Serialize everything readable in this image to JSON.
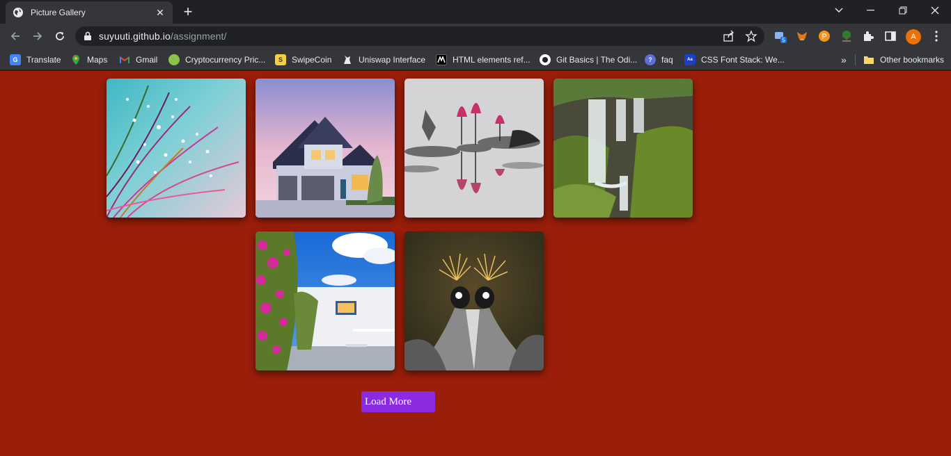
{
  "browser": {
    "tab_title": "Picture Gallery",
    "url_host": "suyuuti.github.io",
    "url_path": "/assignment/",
    "profile_initial": "A",
    "extension_badge": "5"
  },
  "bookmarks": [
    {
      "label": "Translate",
      "icon": "google-translate-icon",
      "color": "#4285f4"
    },
    {
      "label": "Maps",
      "icon": "maps-icon",
      "color": "#34a853"
    },
    {
      "label": "Gmail",
      "icon": "gmail-icon",
      "color": "#ea4335"
    },
    {
      "label": "Cryptocurrency Pric...",
      "icon": "coin-icon",
      "color": "#8bc34a"
    },
    {
      "label": "SwipeCoin",
      "icon": "swipecoin-icon",
      "color": "#f4d03f"
    },
    {
      "label": "Uniswap Interface",
      "icon": "unicorn-icon",
      "color": "#ffffff"
    },
    {
      "label": "HTML elements ref...",
      "icon": "mdn-icon",
      "color": "#000000"
    },
    {
      "label": "Git Basics | The Odi...",
      "icon": "odin-icon",
      "color": "#ffffff"
    },
    {
      "label": "faq",
      "icon": "faq-icon",
      "color": "#5b6ee1"
    },
    {
      "label": "CSS Font Stack: We...",
      "icon": "cssfontstack-icon",
      "color": "#1a3fc9"
    }
  ],
  "other_bookmarks_label": "Other bookmarks",
  "gallery": {
    "images": [
      {
        "subject": "dandelion-dewdrops"
      },
      {
        "subject": "house-at-dusk"
      },
      {
        "subject": "water-lilies"
      },
      {
        "subject": "waterfall"
      },
      {
        "subject": "bougainvillea-house"
      },
      {
        "subject": "crowned-cranes"
      }
    ],
    "load_more_label": "Load More"
  },
  "colors": {
    "page_background": "#9a1e0a",
    "button_background": "#8a2be2"
  }
}
